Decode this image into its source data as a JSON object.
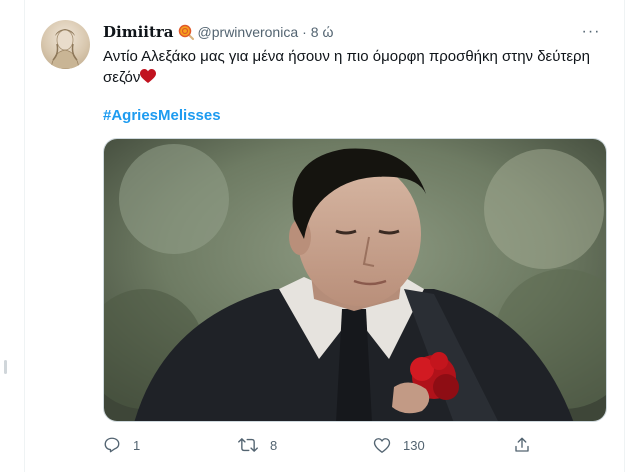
{
  "tweet": {
    "display_name": "Dimiitra",
    "handle": "@prwinveronica",
    "separator": "·",
    "time": "8 ώ",
    "text_line1": "Αντίο Αλεξάκο μας για μένα ήσουν η πιο όμορφη προσθήκη στην δεύτερη",
    "text_line2": "σεζόν",
    "hashtag": "#AgriesMelisses",
    "more_label": "···"
  },
  "actions": {
    "reply_count": "1",
    "retweet_count": "8",
    "like_count": "130"
  },
  "icons": {
    "name_emoji": "lollipop-icon",
    "text_emoji": "red-heart-icon",
    "reply": "reply-icon",
    "retweet": "retweet-icon",
    "like": "like-icon",
    "share": "share-icon"
  },
  "colors": {
    "accent": "#1d9bf0",
    "text": "#0f1419",
    "muted": "#536471",
    "heart": "#c1121f"
  }
}
